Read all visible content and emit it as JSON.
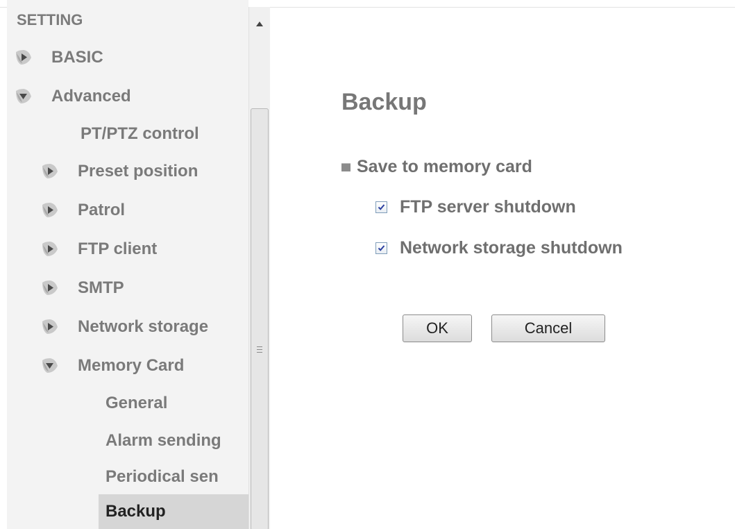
{
  "sidebar": {
    "title": "SETTING",
    "items": [
      {
        "label": "BASIC",
        "icon": "arrow-right-icon"
      },
      {
        "label": "Advanced",
        "icon": "arrow-down-icon"
      },
      {
        "label": "PT/PTZ control",
        "icon": ""
      },
      {
        "label": "Preset position",
        "icon": "arrow-right-icon"
      },
      {
        "label": "Patrol",
        "icon": "arrow-right-icon"
      },
      {
        "label": "FTP client",
        "icon": "arrow-right-icon"
      },
      {
        "label": "SMTP",
        "icon": "arrow-right-icon"
      },
      {
        "label": "Network storage",
        "icon": "arrow-right-icon"
      },
      {
        "label": "Memory Card",
        "icon": "arrow-down-icon"
      },
      {
        "label": "General",
        "icon": ""
      },
      {
        "label": "Alarm sending",
        "icon": ""
      },
      {
        "label": "Periodical sen",
        "icon": ""
      },
      {
        "label": "Backup",
        "icon": "",
        "selected": true
      }
    ]
  },
  "main": {
    "title": "Backup",
    "section_label": "Save to memory card",
    "options": [
      {
        "label": "FTP server shutdown",
        "checked": true
      },
      {
        "label": "Network storage shutdown",
        "checked": true
      }
    ],
    "buttons": {
      "ok_label": "OK",
      "cancel_label": "Cancel"
    }
  },
  "colors": {
    "sidebar_bg": "#f3f3f3",
    "selected_bg": "#d6d6d6",
    "text_gray": "#7a7a7a",
    "check_blue": "#2b3fa0"
  }
}
